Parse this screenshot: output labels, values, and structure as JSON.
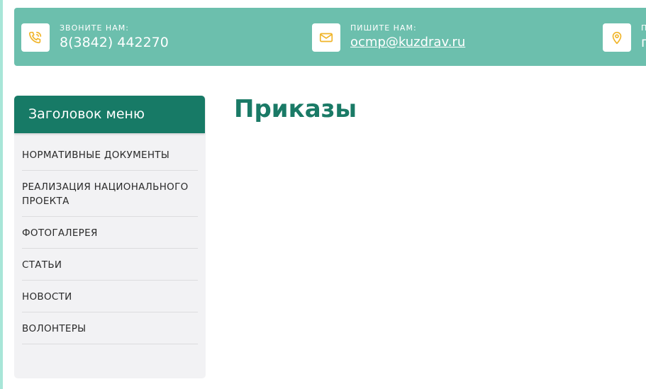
{
  "topbar": {
    "phone": {
      "caption": "ЗВОНИТЕ НАМ:",
      "value": "8(3842) 442270",
      "icon": "phone-icon"
    },
    "email": {
      "caption": "ПИШИТЕ НАМ:",
      "value": "ocmp@kuzdrav.ru",
      "icon": "mail-icon"
    },
    "address": {
      "caption": "П",
      "value": "г",
      "icon": "location-pin-icon"
    }
  },
  "sidebar": {
    "header": "Заголовок меню",
    "items": [
      {
        "label": "НОРМАТИВНЫЕ ДОКУМЕНТЫ"
      },
      {
        "label": "РЕАЛИЗАЦИЯ НАЦИОНАЛЬНОГО ПРОЕКТА"
      },
      {
        "label": "ФОТОГАЛЕРЕЯ"
      },
      {
        "label": "СТАТЬИ"
      },
      {
        "label": "НОВОСТИ"
      },
      {
        "label": "ВОЛОНТЕРЫ"
      }
    ]
  },
  "main": {
    "title": "Приказы"
  },
  "colors": {
    "topbar": "#6cbfad",
    "accent": "#177a66",
    "icon": "#f0b428",
    "sidebar_bg": "#f2f2f4"
  }
}
